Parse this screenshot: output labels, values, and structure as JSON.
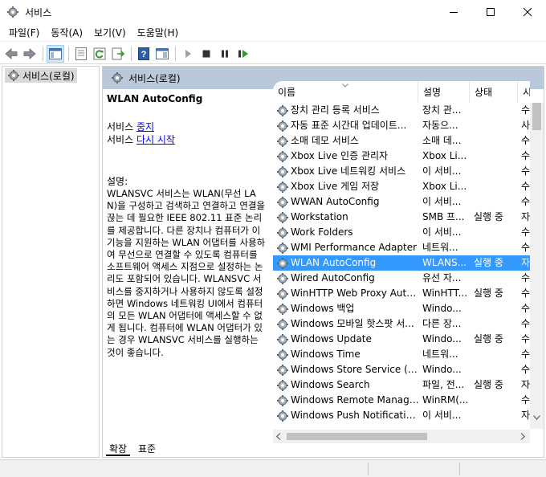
{
  "window": {
    "title": "서비스",
    "min_icon": "minimize-icon",
    "max_icon": "maximize-icon",
    "close_icon": "close-icon"
  },
  "menu": [
    "파일(F)",
    "동작(A)",
    "보기(V)",
    "도움말(H)"
  ],
  "toolbar_icons": [
    "back-arrow-icon",
    "forward-arrow-icon",
    "console-tree-icon",
    "properties-icon",
    "refresh-icon",
    "export-list-icon",
    "help-icon",
    "action-pane-icon",
    "play-icon",
    "stop-icon",
    "pause-icon",
    "restart-icon"
  ],
  "tree": {
    "node": "서비스(로컬)"
  },
  "pane": {
    "header": "서비스(로컬)",
    "selected_name": "WLAN AutoConfig",
    "action1_prefix": "서비스 ",
    "action1_link": "중지",
    "action2_prefix": "서비스 ",
    "action2_link": "다시 시작",
    "desc_label": "설명:",
    "description": "WLANSVC 서비스는 WLAN(무선 LAN)을 구성하고 검색하고 연결하고 연결을 끊는 데 필요한 IEEE 802.11 표준 논리를 제공합니다. 다른 장치나 컴퓨터가 이 기능을 지원하는 WLAN 어댑터를 사용하여 무선으로 연결할 수 있도록 컴퓨터를 소프트웨어 액세스 지점으로 설정하는 논리도 포함되어 있습니다. WLANSVC 서비스를 중지하거나 사용하지 않도록 설정하면 Windows 네트워킹 UI에서 컴퓨터의 모든 WLAN 어댑터에 액세스할 수 없게 됩니다. 컴퓨터에 WLAN 어댑터가 있는 경우 WLANSVC 서비스를 실행하는 것이 좋습니다."
  },
  "columns": {
    "name": "이름",
    "desc": "설명",
    "state": "상태",
    "start": "시"
  },
  "services": [
    {
      "name": "장치 관리 등록 서비스",
      "desc": "장치 관...",
      "state": "",
      "start": "수"
    },
    {
      "name": "자동 표준 시간대 업데이트...",
      "desc": "자동으...",
      "state": "",
      "start": "사"
    },
    {
      "name": "소매 데모 서비스",
      "desc": "소매 데...",
      "state": "",
      "start": "수"
    },
    {
      "name": "Xbox Live 인증 관리자",
      "desc": "Xbox Li...",
      "state": "",
      "start": "수"
    },
    {
      "name": "Xbox Live 네트워킹 서비스",
      "desc": "이 서비...",
      "state": "",
      "start": "수"
    },
    {
      "name": "Xbox Live 게임 저장",
      "desc": "Xbox Li...",
      "state": "",
      "start": "수"
    },
    {
      "name": "WWAN AutoConfig",
      "desc": "이 서비...",
      "state": "",
      "start": "수"
    },
    {
      "name": "Workstation",
      "desc": "SMB 프...",
      "state": "실행 중",
      "start": "자"
    },
    {
      "name": "Work Folders",
      "desc": "이 서비...",
      "state": "",
      "start": "수"
    },
    {
      "name": "WMI Performance Adapter",
      "desc": "네트워...",
      "state": "",
      "start": "수"
    },
    {
      "name": "WLAN AutoConfig",
      "desc": "WLANS...",
      "state": "실행 중",
      "start": "자"
    },
    {
      "name": "Wired AutoConfig",
      "desc": "유선 자...",
      "state": "",
      "start": "수"
    },
    {
      "name": "WinHTTP Web Proxy Auto-...",
      "desc": "WinHTT...",
      "state": "실행 중",
      "start": "수"
    },
    {
      "name": "Windows 백업",
      "desc": "Windo...",
      "state": "",
      "start": "수"
    },
    {
      "name": "Windows 모바일 핫스팟 서...",
      "desc": "다른 장...",
      "state": "",
      "start": "수"
    },
    {
      "name": "Windows Update",
      "desc": "Windo...",
      "state": "실행 중",
      "start": "수"
    },
    {
      "name": "Windows Time",
      "desc": "네트워...",
      "state": "",
      "start": "수"
    },
    {
      "name": "Windows Store Service (W...",
      "desc": "Windo...",
      "state": "",
      "start": "수"
    },
    {
      "name": "Windows Search",
      "desc": "파일, 전...",
      "state": "실행 중",
      "start": "자"
    },
    {
      "name": "Windows Remote Manage...",
      "desc": "WinRM(...",
      "state": "",
      "start": "수"
    },
    {
      "name": "Windows Push Notification...",
      "desc": "이 서비...",
      "state": "",
      "start": "자"
    }
  ],
  "selected_index": 10,
  "tabs": [
    "확장",
    "표준"
  ]
}
